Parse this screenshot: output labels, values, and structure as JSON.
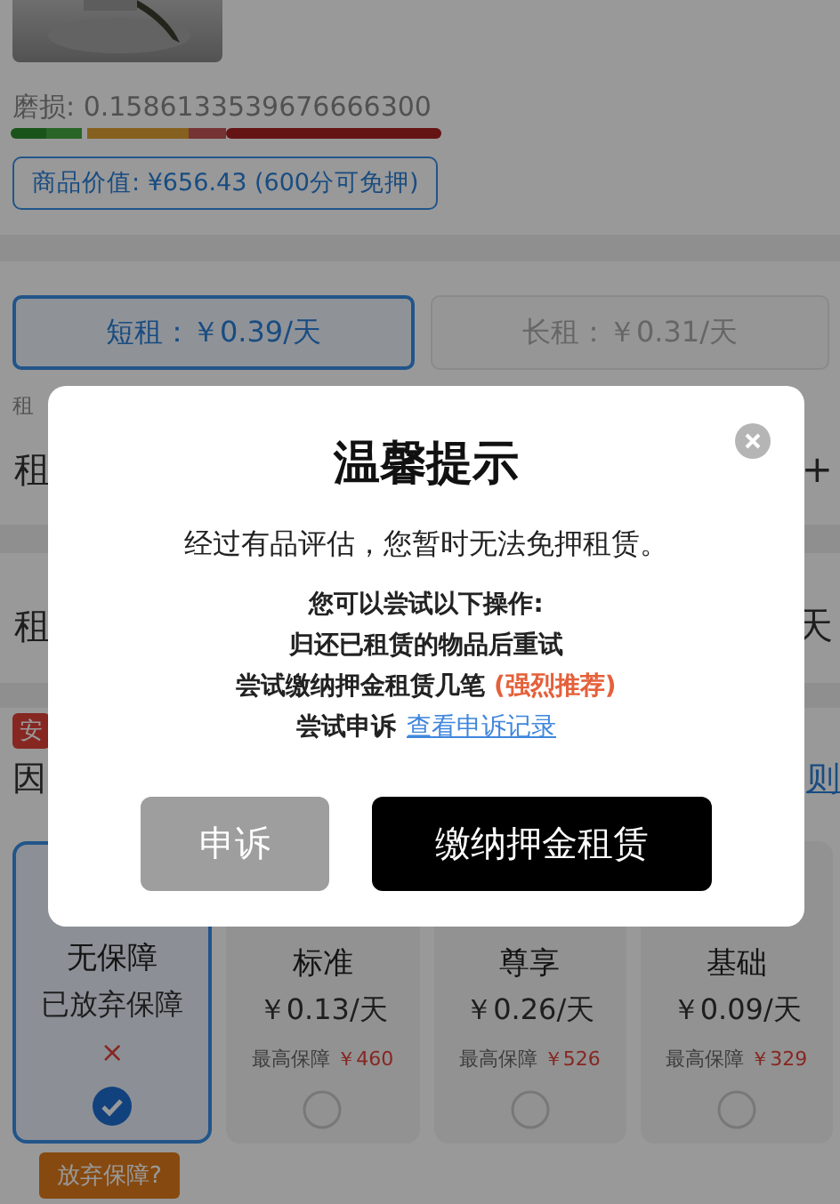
{
  "product": {
    "wear_label": "磨损: 0.1586133539676666300",
    "value_tag": "商品价值: ¥656.43 (600分可免押)"
  },
  "rent_options": [
    {
      "label": "短租：￥0.39/天",
      "selected": true
    },
    {
      "label": "长租：￥0.31/天",
      "selected": false
    }
  ],
  "hint": "租",
  "duration_row": {
    "label": "租",
    "control": "+"
  },
  "period_row": {
    "label": "租",
    "value": "天"
  },
  "insurance": {
    "tag": "安",
    "note": "因",
    "link": "则",
    "plans": [
      {
        "kind": "waived",
        "name": "无保障",
        "price": "已放弃保障",
        "mark": "×",
        "selected": true
      },
      {
        "kind": "plan",
        "name": "标准",
        "price": "￥0.13/天",
        "cover_label": "最高保障",
        "cover_amount": "￥460",
        "selected": false
      },
      {
        "kind": "plan",
        "name": "尊享",
        "price": "￥0.26/天",
        "cover_label": "最高保障",
        "cover_amount": "￥526",
        "selected": false
      },
      {
        "kind": "plan",
        "name": "基础",
        "price": "￥0.09/天",
        "cover_label": "最高保障",
        "cover_amount": "￥329",
        "selected": false
      }
    ],
    "tooltip": "放弃保障?"
  },
  "dialog": {
    "title": "温馨提示",
    "message": "经过有品评估，您暂时无法免押租赁。",
    "subtitle": "您可以尝试以下操作:",
    "lines": [
      {
        "text": "归还已租赁的物品后重试"
      },
      {
        "text": "尝试缴纳押金租赁几笔",
        "highlight": "(强烈推荐)"
      },
      {
        "text": "尝试申诉",
        "link": "查看申诉记录"
      }
    ],
    "buttons": [
      {
        "label": "申诉",
        "kind": "secondary"
      },
      {
        "label": "缴纳押金租赁",
        "kind": "primary"
      }
    ]
  }
}
